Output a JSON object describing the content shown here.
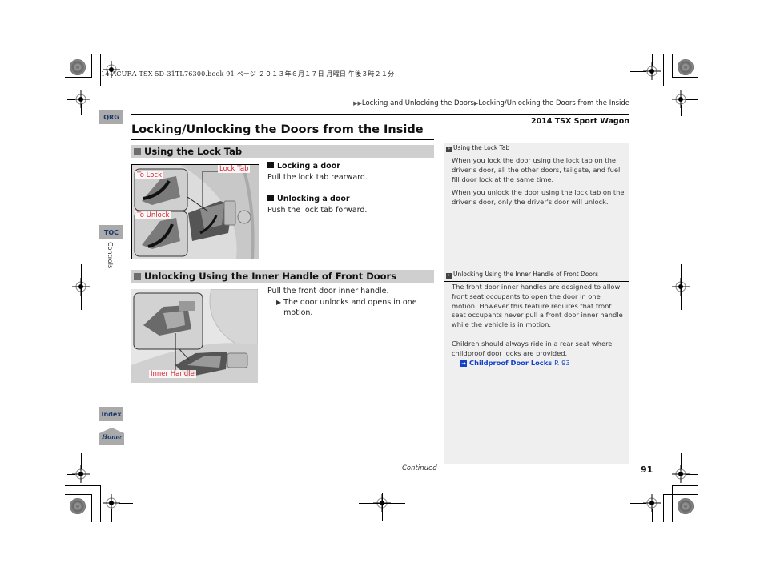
{
  "print_header": "14 ACURA TSX 5D-31TL76300.book  91 ページ  ２０１３年６月１７日  月曜日  午後３時２１分",
  "breadcrumb": {
    "items": [
      "Locking and Unlocking the Doors",
      "Locking/Unlocking the Doors from the Inside"
    ]
  },
  "model": "2014 TSX Sport Wagon",
  "side_nav": {
    "qrg": "QRG",
    "toc": "TOC",
    "chapter": "Controls",
    "index": "Index",
    "home": "Home"
  },
  "page_title": "Locking/Unlocking the Doors from the Inside",
  "sections": [
    {
      "heading": "Using the Lock Tab",
      "illustration": {
        "callouts": [
          "To Lock",
          "Lock Tab",
          "To Unlock"
        ]
      },
      "steps": [
        {
          "subheading": "Locking a door",
          "text": "Pull the lock tab rearward."
        },
        {
          "subheading": "Unlocking a door",
          "text": "Push the lock tab forward."
        }
      ]
    },
    {
      "heading": "Unlocking Using the Inner Handle of Front Doors",
      "illustration": {
        "callouts": [
          "Inner Handle"
        ]
      },
      "text": "Pull the front door inner handle.",
      "result": "The door unlocks and opens in one motion."
    }
  ],
  "notes": [
    {
      "title": "Using the Lock Tab",
      "paragraphs": [
        "When you lock the door using the lock tab on the driver's door, all the other doors, tailgate, and fuel fill door lock at the same time.",
        "When you unlock the door using the lock tab on the driver's door, only the driver's door will unlock."
      ]
    },
    {
      "title": "Unlocking Using the Inner Handle of Front Doors",
      "paragraphs": [
        "The front door inner handles are designed to allow front seat occupants to open the door in one motion. However this feature requires that front seat occupants never pull a front door inner handle while the vehicle is in motion.",
        "Children should always ride in a rear seat where childproof door locks are provided."
      ],
      "xref": {
        "label": "Childproof Door Locks",
        "page": "P. 93"
      }
    }
  ],
  "footer": {
    "continued": "Continued",
    "page_number": "91"
  }
}
